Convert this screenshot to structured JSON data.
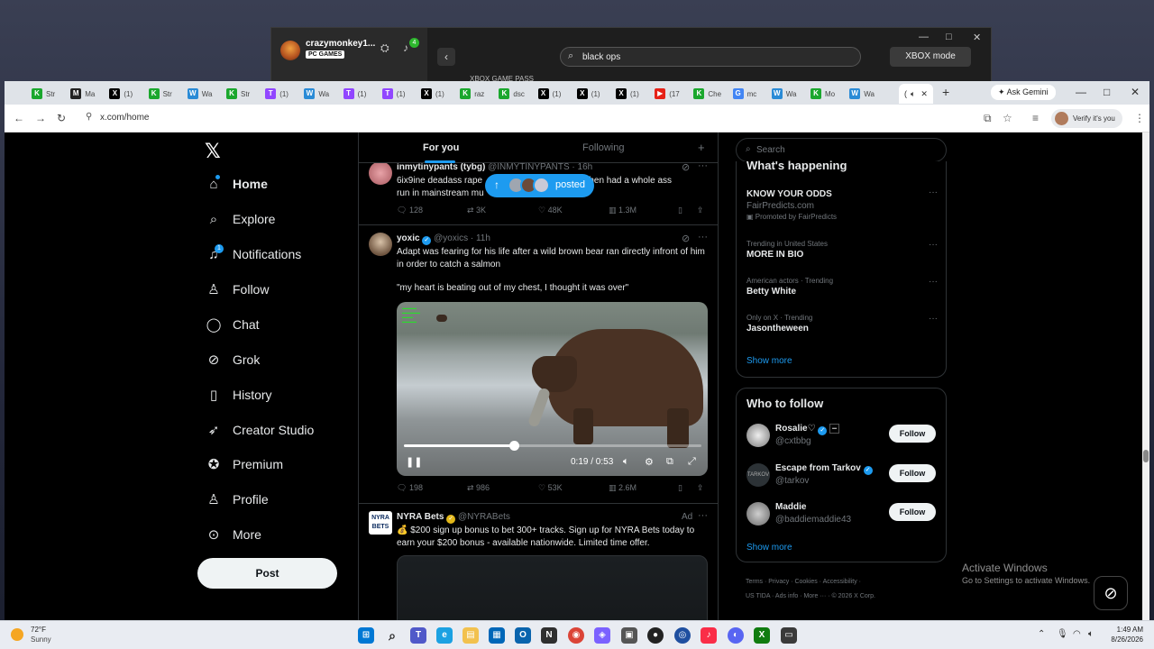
{
  "xbox": {
    "username": "crazymonkey1...",
    "badge": "PC GAMES",
    "notif_count": "4",
    "search_value": "black ops",
    "mode_button": "XBOX mode",
    "game_pass": "XBOX GAME PASS"
  },
  "browser": {
    "tabs": [
      {
        "label": "Str",
        "color": "#1aa72d",
        "glyph": "K"
      },
      {
        "label": "Ma",
        "color": "#222222",
        "glyph": "M"
      },
      {
        "label": "(1)",
        "color": "#000000",
        "glyph": "X"
      },
      {
        "label": "Str",
        "color": "#1aa72d",
        "glyph": "K"
      },
      {
        "label": "Wa",
        "color": "#2a8bd6",
        "glyph": "W"
      },
      {
        "label": "Str",
        "color": "#1aa72d",
        "glyph": "K"
      },
      {
        "label": "(1)",
        "color": "#9146ff",
        "glyph": "T"
      },
      {
        "label": "Wa",
        "color": "#2a8bd6",
        "glyph": "W"
      },
      {
        "label": "(1)",
        "color": "#9146ff",
        "glyph": "T"
      },
      {
        "label": "(1)",
        "color": "#9146ff",
        "glyph": "T"
      },
      {
        "label": "(1)",
        "color": "#000000",
        "glyph": "X"
      },
      {
        "label": "raz",
        "color": "#1aa72d",
        "glyph": "K"
      },
      {
        "label": "dsc",
        "color": "#1aa72d",
        "glyph": "K"
      },
      {
        "label": "(1)",
        "color": "#000000",
        "glyph": "X"
      },
      {
        "label": "(1)",
        "color": "#000000",
        "glyph": "X"
      },
      {
        "label": "(1)",
        "color": "#000000",
        "glyph": "X"
      },
      {
        "label": "(17",
        "color": "#e62117",
        "glyph": "▶"
      },
      {
        "label": "Che",
        "color": "#1aa72d",
        "glyph": "K"
      },
      {
        "label": "mc",
        "color": "#4285f4",
        "glyph": "G"
      },
      {
        "label": "Wa",
        "color": "#2a8bd6",
        "glyph": "W"
      },
      {
        "label": "Mo",
        "color": "#1aa72d",
        "glyph": "K"
      },
      {
        "label": "Wa",
        "color": "#2a8bd6",
        "glyph": "W"
      }
    ],
    "active_tab_label": "(",
    "ask_gemini": "Ask Gemini",
    "url": "x.com/home",
    "verify_label": "Verify it's you"
  },
  "nav": {
    "items": [
      {
        "label": "Home",
        "icon": "home-icon",
        "glyph": "⌂"
      },
      {
        "label": "Explore",
        "icon": "search-icon",
        "glyph": "⌕"
      },
      {
        "label": "Notifications",
        "icon": "bell-icon",
        "glyph": "♫"
      },
      {
        "label": "Follow",
        "icon": "person-add-icon",
        "glyph": "♙"
      },
      {
        "label": "Chat",
        "icon": "chat-icon",
        "glyph": "◯"
      },
      {
        "label": "Grok",
        "icon": "grok-icon",
        "glyph": "⊘"
      },
      {
        "label": "History",
        "icon": "bookmark-icon",
        "glyph": "▯"
      },
      {
        "label": "Creator Studio",
        "icon": "rocket-icon",
        "glyph": "➶"
      },
      {
        "label": "Premium",
        "icon": "verified-icon",
        "glyph": "✪"
      },
      {
        "label": "Profile",
        "icon": "person-icon",
        "glyph": "♙"
      },
      {
        "label": "More",
        "icon": "more-circle-icon",
        "glyph": "⊙"
      }
    ],
    "notif_count": "1",
    "post_label": "Post"
  },
  "timeline": {
    "tabs": [
      "For you",
      "Following"
    ],
    "posted_label": "posted",
    "tweets": [
      {
        "name": "inmytinypants (tybg)",
        "handle": "@INMYTINYPANTS · 16h",
        "text_a": "6ix9ine deadass rape",
        "text_b": "and then had a whole ass",
        "text_c": "run in mainstream mu",
        "replies": "128",
        "reposts": "3K",
        "likes": "48K",
        "views": "1.3M"
      },
      {
        "name": "yoxic",
        "handle": "@yoxics · 11h",
        "text": "Adapt was fearing for his life after a wild brown bear ran directly infront of him in order to catch a salmon",
        "quote": "\"my heart is beating out of my chest, I thought it was over\"",
        "video_time": "0:19 / 0:53",
        "video_progress": 0.37,
        "replies": "198",
        "reposts": "986",
        "likes": "53K",
        "views": "2.6M"
      },
      {
        "name": "NYRA Bets",
        "handle": "@NYRABets",
        "ad_label": "Ad",
        "text": "💰 $200 sign up bonus to bet 300+ tracks. Sign up for NYRA Bets today to earn your $200 bonus - available nationwide. Limited time offer.",
        "avatar_text": "NYRA BETS"
      }
    ]
  },
  "right": {
    "search_placeholder": "Search",
    "happening_title": "What's happening",
    "trends": [
      {
        "name": "KNOW YOUR ODDS",
        "sub": "FairPredicts.com",
        "promo": "Promoted by FairPredicts"
      },
      {
        "context": "Trending in United States",
        "name": "MORE IN BIO"
      },
      {
        "context": "American actors · Trending",
        "name": "Betty White"
      },
      {
        "context": "Only on X · Trending",
        "name": "Jasontheween"
      }
    ],
    "show_more": "Show more",
    "wtf_title": "Who to follow",
    "follow_suggestions": [
      {
        "name": "Rosalie♡",
        "handle": "@cxtbbg",
        "button": "Follow"
      },
      {
        "name": "Escape from Tarkov",
        "handle": "@tarkov",
        "button": "Follow"
      },
      {
        "name": "Maddie",
        "handle": "@baddiemaddie43",
        "button": "Follow"
      }
    ],
    "footer_line1": "Terms  ·  Privacy  ·  Cookies  ·  Accessibility  ·",
    "footer_line2": "US TIDA  ·  Ads info  ·  More ···  ·  © 2026 X Corp."
  },
  "watermark": {
    "line1": "Activate Windows",
    "line2": "Go to Settings to activate Windows."
  },
  "taskbar": {
    "temp": "72°F",
    "condition": "Sunny",
    "time": "1:49 AM",
    "date": "8/26/2026"
  }
}
